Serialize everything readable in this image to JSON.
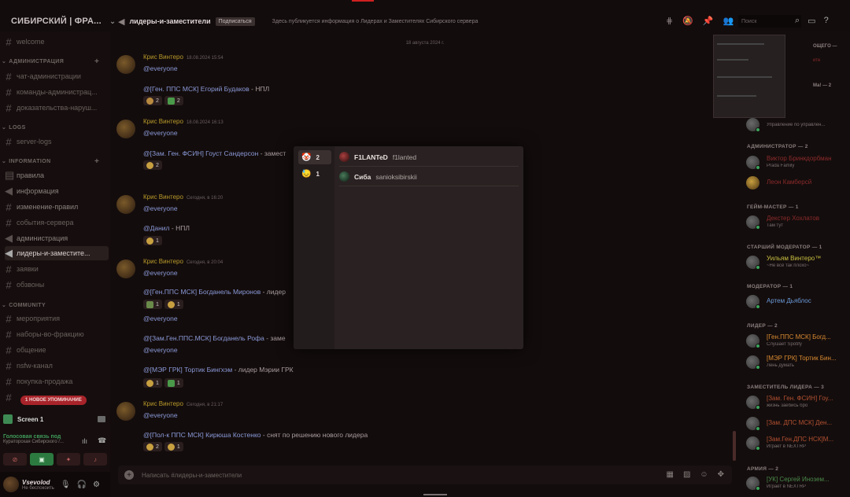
{
  "server": {
    "name": "СИБИРСКИЙ | ФРА..."
  },
  "channel_header": {
    "name": "лидеры-и-заместители",
    "follow_label": "Подписаться",
    "topic": "Здесь публикуется информация о Лидерах и Заместителях Сибирского сервера",
    "search_placeholder": "Поиск"
  },
  "sidebar": {
    "top_channel": "welcome",
    "categories": [
      {
        "name": "АДМИНИСТРАЦИЯ",
        "channels": [
          "чат-администрации",
          "команды-администрац...",
          "доказательства-наруш..."
        ]
      },
      {
        "name": "LOGS",
        "channels": [
          "server-logs"
        ]
      },
      {
        "name": "INFORMATION",
        "channels": [
          "правила",
          "информация",
          "изменение-правил",
          "события-сервера",
          "администрация",
          "лидеры-и-заместите...",
          "заявки",
          "обзвоны"
        ]
      },
      {
        "name": "COMMUNITY",
        "channels": [
          "мероприятия",
          "наборы-во-фракцию",
          "общение",
          "nsfw-канал",
          "покупка-продажа"
        ]
      }
    ],
    "new_mention": "1 НОВОЕ УПОМИНАНИЕ"
  },
  "voice": {
    "screen_label": "Screen 1",
    "status": "Голосовая связь под",
    "channel": "Кураторская Сибирского /..."
  },
  "user_panel": {
    "name": "Vsevolod",
    "status": "Не беспокоить"
  },
  "messages": {
    "date_divider": "18 августа 2024 г.",
    "composer_placeholder": "Написать #лидеры-и-заместители",
    "items": [
      {
        "author": "Крис Винтеро",
        "time": "18.08.2024 15:54",
        "mention": "@everyone",
        "role": "@[Ген. ППС МСК] Егорий Будаков",
        "text": " - НПЛ",
        "reactions": [
          "2",
          "2"
        ]
      },
      {
        "author": "Крис Винтеро",
        "time": "18.08.2024 16:13",
        "mention": "@everyone",
        "role": "@[Зам. Ген. ФСИН] Гоуст Сандерсон",
        "text": " - замест",
        "reactions": [
          "2"
        ]
      },
      {
        "author": "Крис Винтеро",
        "time": "Сегодня, в 16:20",
        "mention": "@everyone",
        "role": "@Данил",
        "text": " - НПЛ",
        "reactions": [
          "1"
        ]
      },
      {
        "author": "Крис Винтеро",
        "time": "Сегодня, в 20:04",
        "mention": "@everyone",
        "lines": [
          {
            "role": "@[Ген.ППС МСК] Богданель Миронов",
            "text": " - лидер"
          },
          {
            "role": "@[Зам.Ген.ППС.МСК] Богданель Рофа",
            "text": " - заме"
          },
          {
            "role": "@[МЭР ГРК] Тортик Бингхэм",
            "text": " - лидер Мэрии ГРК"
          }
        ],
        "reactions_a": [
          "1",
          "1"
        ],
        "reactions_b": [
          "1",
          "1"
        ]
      },
      {
        "author": "Крис Винтеро",
        "time": "Сегодня, в 21:17",
        "mention": "@everyone",
        "role": "@[Пол-к ППС МСК] Кирюша Костенко",
        "text": " - снят по решению нового лидера",
        "reactions": [
          "2",
          "1"
        ]
      }
    ]
  },
  "reaction_popup": {
    "reactions": [
      {
        "emoji": "clown-emoji",
        "count": "2"
      },
      {
        "emoji": "face-emoji",
        "count": "1"
      }
    ],
    "users": [
      {
        "display": "F1LANTeD",
        "username": "f1lanted"
      },
      {
        "display": "Сиба",
        "username": "sanioksibirskii"
      }
    ]
  },
  "members": {
    "top_partial": [
      "ОЩЕГО —",
      "ите",
      "Ма! — 2"
    ],
    "partial_user": {
      "name": "...",
      "status": "Управление по управлен..."
    },
    "groups": [
      {
        "title": "АДМИНИСТРАТОР — 2",
        "members": [
          {
            "name": "Виктор Бринкдорбман",
            "status": "Prada Family",
            "color": "#8a2a2a"
          },
          {
            "name": "Леон Камберсй",
            "status": "",
            "color": "#8a2a2a"
          }
        ]
      },
      {
        "title": "ГЕЙМ-МАСТЕР — 1",
        "members": [
          {
            "name": "Декстер Хохлатов",
            "status": "Там тут",
            "color": "#8a2a2a"
          }
        ]
      },
      {
        "title": "СТАРШИЙ МОДЕРАТОР — 1",
        "members": [
          {
            "name": "Уильям Винтеро™",
            "status": "~Не всё так плохо~",
            "color": "#c8c040"
          }
        ]
      },
      {
        "title": "МОДЕРАТОР — 1",
        "members": [
          {
            "name": "Артем Дьяблос",
            "status": "",
            "color": "#6a9ad8"
          }
        ]
      },
      {
        "title": "ЛИДЕР — 2",
        "members": [
          {
            "name": "[Ген.ППС МСК] Богд...",
            "status": "Слушает Spotify",
            "color": "#d88a30"
          },
          {
            "name": "[МЭР ГРК] Тортик Бин...",
            "status": "Лень думать",
            "color": "#d88a30"
          }
        ]
      },
      {
        "title": "ЗАМЕСТИТЕЛЬ ЛИДЕРА — 3",
        "members": [
          {
            "name": "[Зам. Ген. ФСИН] Гоу...",
            "status": "жизнь заебись бро",
            "color": "#b05030"
          },
          {
            "name": "[Зам. ДПС МСК] Ден...",
            "status": "",
            "color": "#b05030"
          },
          {
            "name": "[Зам.Ген.ДПС НСК]М...",
            "status": "Играет в NEXTRP",
            "color": "#b05030"
          }
        ]
      },
      {
        "title": "АРМИЯ — 2",
        "members": [
          {
            "name": "[УК] Сергей Инозем...",
            "status": "Играет в NEXTRP",
            "color": "#4a8a4a"
          }
        ]
      }
    ]
  },
  "colors": {
    "accent": "#a8242a",
    "mention": "#8a9ad8",
    "author": "#b89a2a"
  }
}
